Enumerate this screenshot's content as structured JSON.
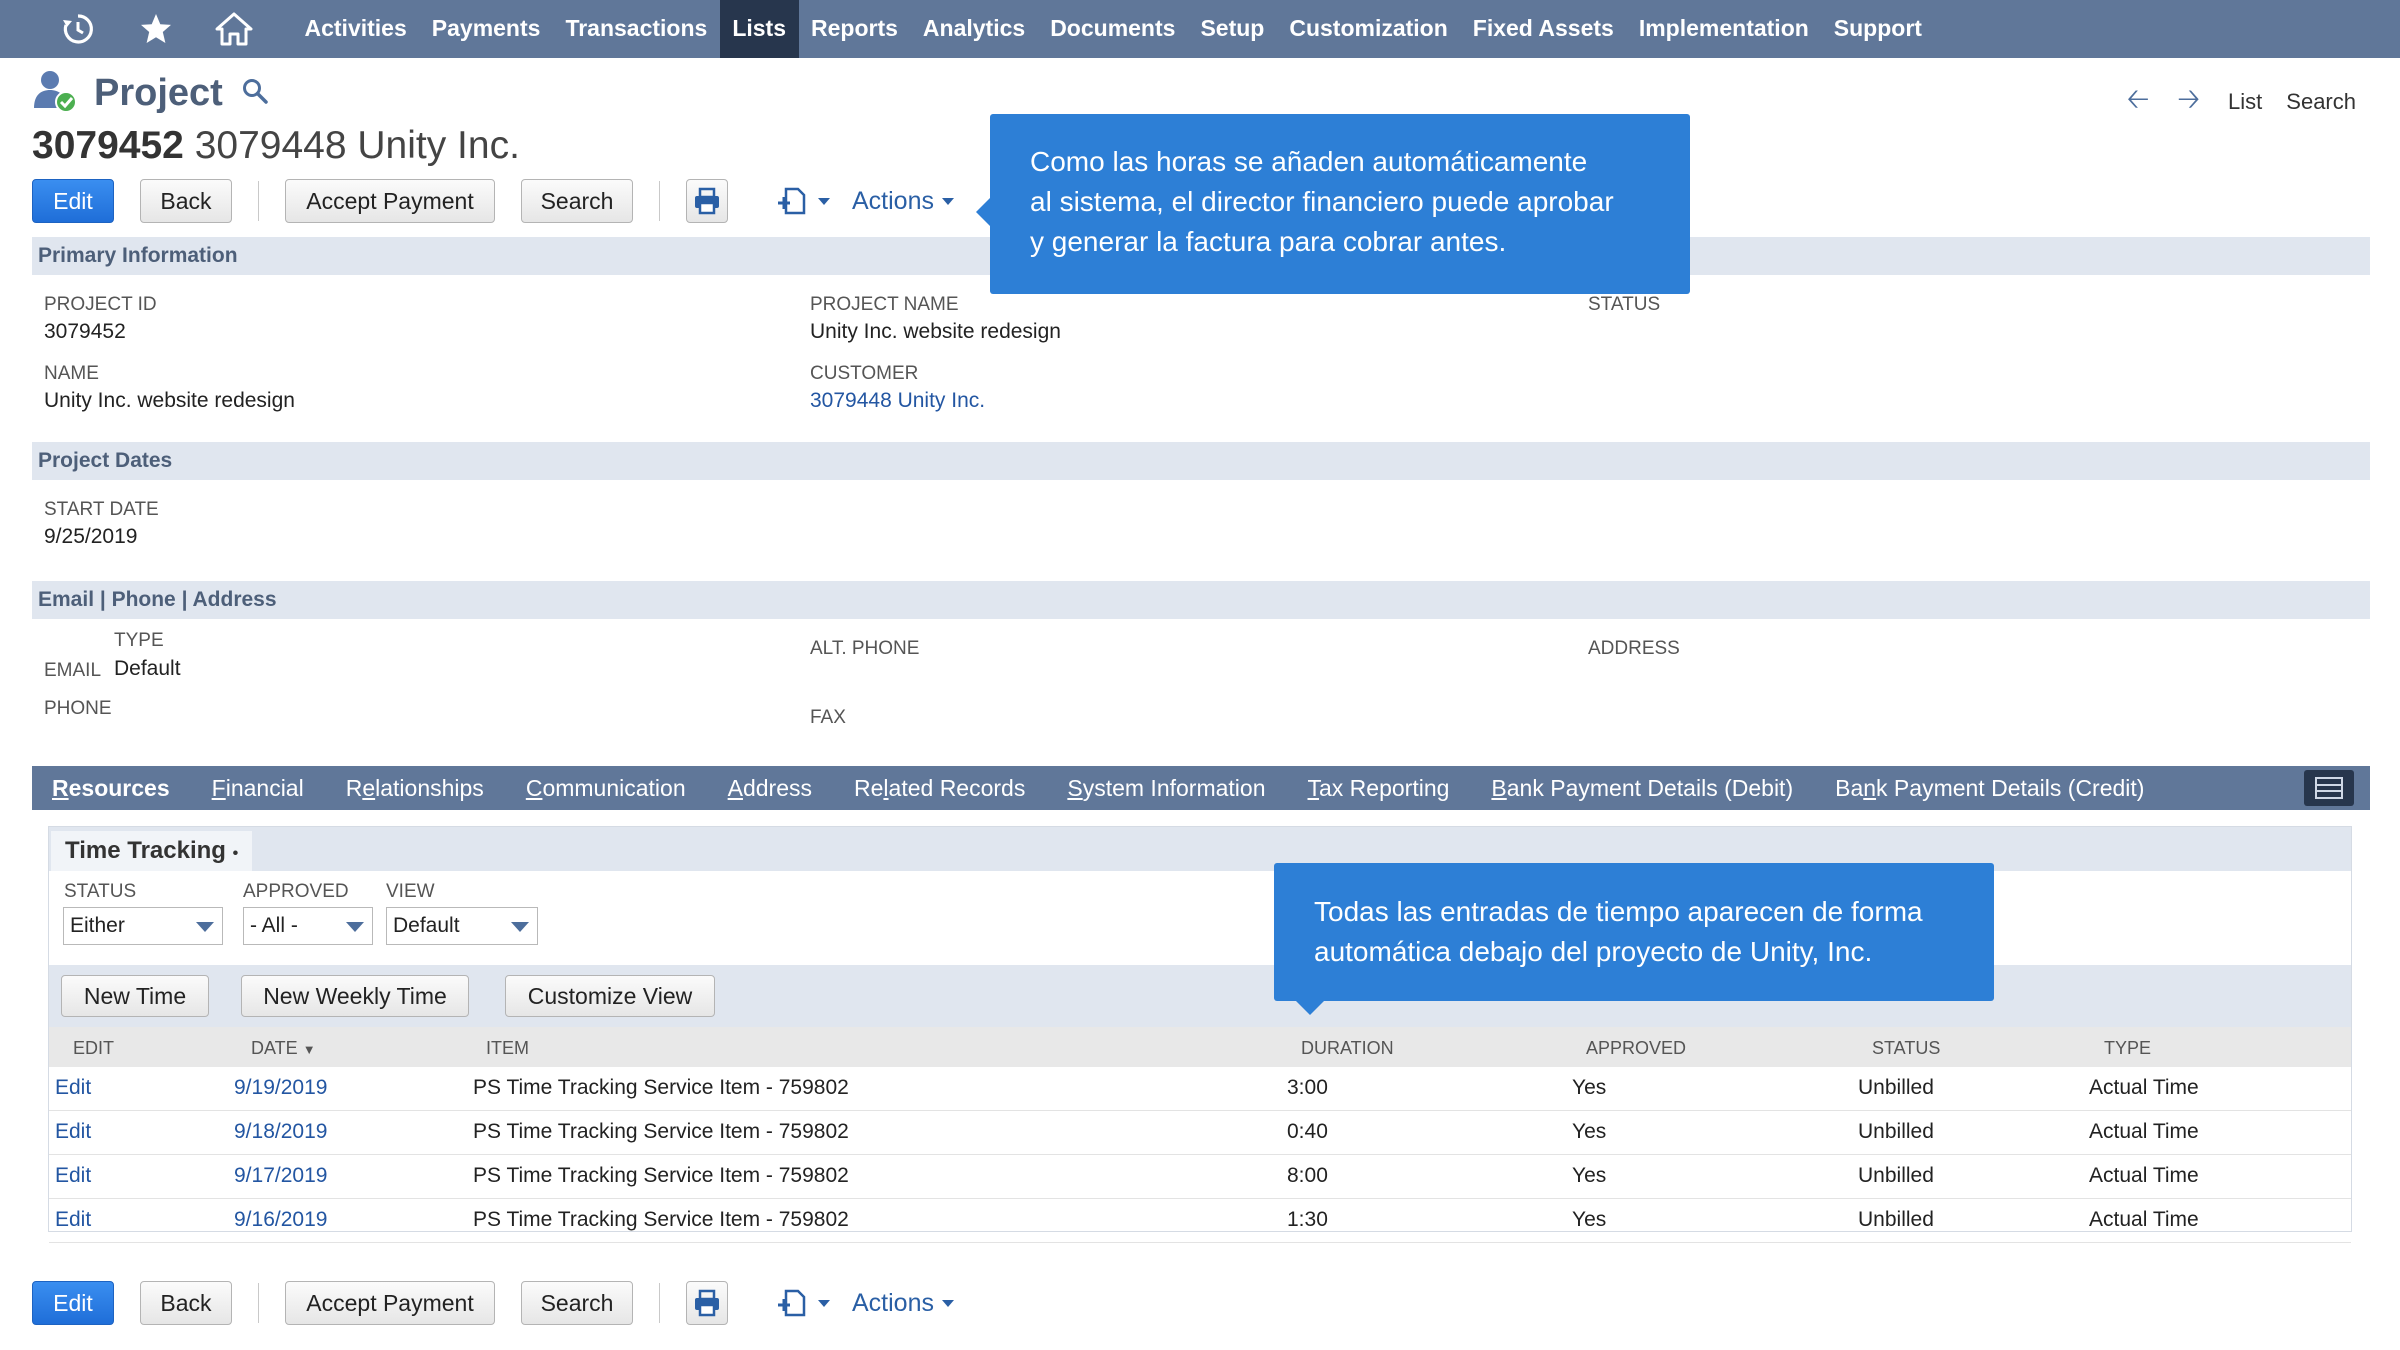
{
  "nav": {
    "items": [
      "Activities",
      "Payments",
      "Transactions",
      "Lists",
      "Reports",
      "Analytics",
      "Documents",
      "Setup",
      "Customization",
      "Fixed Assets",
      "Implementation",
      "Support"
    ],
    "active": "Lists",
    "icons": [
      "history-icon",
      "star-icon",
      "home-icon"
    ]
  },
  "header": {
    "record_type": "Project",
    "record_number": "3079452",
    "record_name": "3079448 Unity Inc.",
    "right_links": [
      "List",
      "Search"
    ]
  },
  "toolbar": {
    "edit": "Edit",
    "back": "Back",
    "accept_payment": "Accept Payment",
    "search": "Search",
    "actions": "Actions"
  },
  "primary": {
    "title": "Primary Information",
    "project_id_label": "PROJECT ID",
    "project_id": "3079452",
    "project_name_label": "PROJECT NAME",
    "project_name": "Unity Inc. website redesign",
    "status_label": "STATUS",
    "name_label": "NAME",
    "name": "Unity Inc. website redesign",
    "customer_label": "CUSTOMER",
    "customer": "3079448 Unity Inc."
  },
  "dates": {
    "title": "Project Dates",
    "start_date_label": "START DATE",
    "start_date": "9/25/2019"
  },
  "contact": {
    "title": "Email | Phone | Address",
    "type_label": "TYPE",
    "email_label": "EMAIL",
    "email_type": "Default",
    "phone_label": "PHONE",
    "alt_phone_label": "ALT. PHONE",
    "fax_label": "FAX",
    "address_label": "ADDRESS"
  },
  "tabs": [
    {
      "pre": "",
      "u": "R",
      "post": "esources"
    },
    {
      "pre": "",
      "u": "F",
      "post": "inancial"
    },
    {
      "pre": "R",
      "u": "e",
      "post": "lationships"
    },
    {
      "pre": "",
      "u": "C",
      "post": "ommunication"
    },
    {
      "pre": "",
      "u": "A",
      "post": "ddress"
    },
    {
      "pre": "Re",
      "u": "l",
      "post": "ated Records"
    },
    {
      "pre": "",
      "u": "S",
      "post": "ystem Information"
    },
    {
      "pre": "",
      "u": "T",
      "post": "ax Reporting"
    },
    {
      "pre": "",
      "u": "B",
      "post": "ank Payment Details (Debit)"
    },
    {
      "pre": "Ba",
      "u": "n",
      "post": "k Payment Details (Credit)"
    }
  ],
  "time_tracking": {
    "subtab": "Time Tracking",
    "filters": {
      "status_label": "STATUS",
      "status": "Either",
      "approved_label": "APPROVED",
      "approved": "- All -",
      "view_label": "VIEW",
      "view": "Default"
    },
    "buttons": [
      "New Time",
      "New Weekly Time",
      "Customize View"
    ],
    "columns": [
      "EDIT",
      "DATE",
      "ITEM",
      "DURATION",
      "APPROVED",
      "STATUS",
      "TYPE"
    ],
    "rows": [
      {
        "edit": "Edit",
        "date": "9/19/2019",
        "item": "PS Time Tracking Service Item - 759802",
        "duration": "3:00",
        "approved": "Yes",
        "status": "Unbilled",
        "type": "Actual Time"
      },
      {
        "edit": "Edit",
        "date": "9/18/2019",
        "item": "PS Time Tracking Service Item - 759802",
        "duration": "0:40",
        "approved": "Yes",
        "status": "Unbilled",
        "type": "Actual Time"
      },
      {
        "edit": "Edit",
        "date": "9/17/2019",
        "item": "PS Time Tracking Service Item - 759802",
        "duration": "8:00",
        "approved": "Yes",
        "status": "Unbilled",
        "type": "Actual Time"
      },
      {
        "edit": "Edit",
        "date": "9/16/2019",
        "item": "PS Time Tracking Service Item - 759802",
        "duration": "1:30",
        "approved": "Yes",
        "status": "Unbilled",
        "type": "Actual Time"
      }
    ]
  },
  "callouts": {
    "top": [
      "Como las horas se añaden automáticamente",
      "al sistema, el director financiero puede aprobar",
      "y generar la factura para cobrar antes."
    ],
    "bottom": [
      "Todas las entradas de tiempo aparecen de forma",
      "automática debajo del proyecto de Unity, Inc."
    ]
  },
  "colors": {
    "nav_bg": "#607799",
    "nav_active": "#27364d",
    "section_bg": "#e0e6ef",
    "link": "#2356a2",
    "callout": "#2d7fd6",
    "primary_button": "#1f6ed8"
  }
}
